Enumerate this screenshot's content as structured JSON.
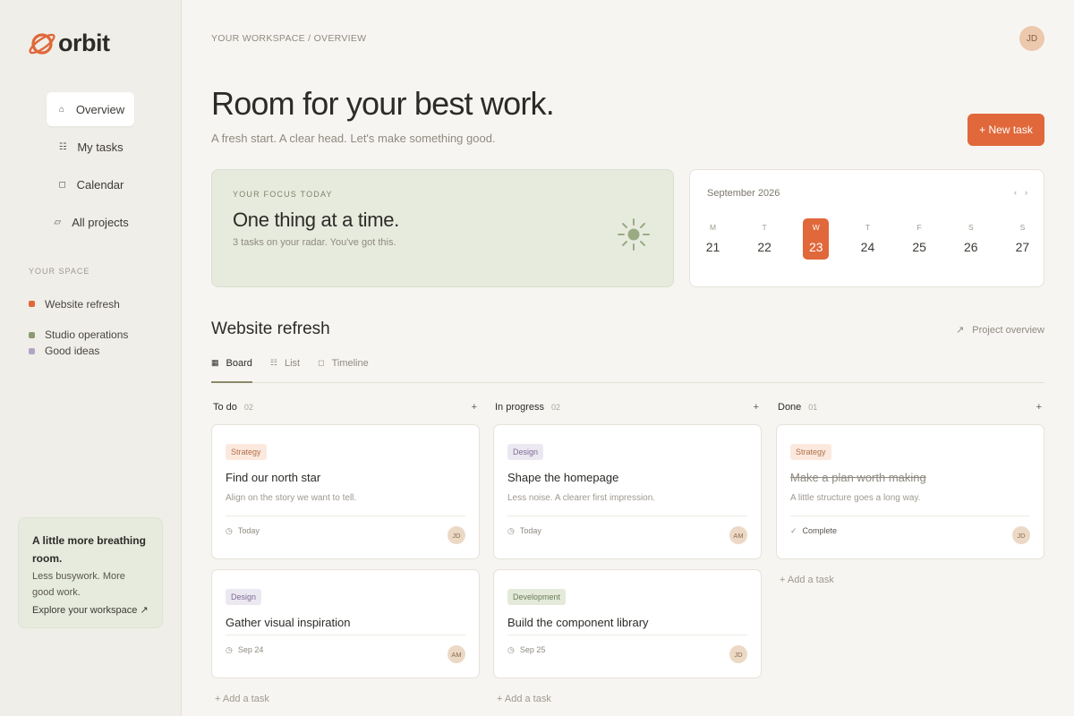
{
  "app": {
    "name": "orbit"
  },
  "sidebar": {
    "nav": [
      {
        "label": "Overview",
        "icon": "⌂",
        "active": true
      },
      {
        "label": "My tasks",
        "icon": "☷",
        "active": false
      },
      {
        "label": "Calendar",
        "icon": "◻",
        "active": false
      },
      {
        "label": "All projects",
        "icon": "▱",
        "active": false
      }
    ],
    "space_label": "YOUR SPACE",
    "spaces": [
      {
        "label": "Website refresh",
        "color": "#e0683a"
      },
      {
        "label": "Studio operations",
        "color": "#8a9a72"
      },
      {
        "label": "Good ideas",
        "color": "#b3a3c8"
      }
    ],
    "promo": {
      "title": "A little more breathing room.",
      "body": "Less busywork. More good work.",
      "link": "Explore your workspace ↗"
    }
  },
  "header": {
    "breadcrumb": "YOUR WORKSPACE / OVERVIEW",
    "avatar": "JD",
    "title": "Room for your best work.",
    "subtitle": "A fresh start. A clear head. Let's make something good.",
    "new_task": "+ New task"
  },
  "focus": {
    "label": "YOUR FOCUS TODAY",
    "title": "One thing at a time.",
    "subtitle": "3 tasks on your radar. You've got this."
  },
  "calendar": {
    "month": "September 2026",
    "prev": "‹",
    "next": "›",
    "days": [
      {
        "dow": "M",
        "num": "21",
        "active": false
      },
      {
        "dow": "T",
        "num": "22",
        "active": false
      },
      {
        "dow": "W",
        "num": "23",
        "active": true
      },
      {
        "dow": "T",
        "num": "24",
        "active": false
      },
      {
        "dow": "F",
        "num": "25",
        "active": false
      },
      {
        "dow": "S",
        "num": "26",
        "active": false
      },
      {
        "dow": "S",
        "num": "27",
        "active": false
      }
    ]
  },
  "project": {
    "title": "Website refresh",
    "overview_link": "Project overview",
    "tabs": [
      {
        "label": "Board",
        "icon": "▦",
        "active": true
      },
      {
        "label": "List",
        "icon": "☷",
        "active": false
      },
      {
        "label": "Timeline",
        "icon": "◻",
        "active": false
      }
    ]
  },
  "columns": [
    {
      "name": "To do",
      "count": "02",
      "add": "+",
      "add_task": "+ Add a task",
      "cards": [
        {
          "tag": "Strategy",
          "tag_type": "strategy",
          "title": "Find our north star",
          "desc": "Align on the story we want to tell.",
          "due": "Today",
          "due_icon": "◷",
          "avatar": "JD",
          "done": false
        },
        {
          "tag": "Design",
          "tag_type": "design",
          "title": "Gather visual inspiration",
          "desc": "",
          "due": "Sep 24",
          "due_icon": "◷",
          "avatar": "AM",
          "done": false
        }
      ]
    },
    {
      "name": "In progress",
      "count": "02",
      "add": "+",
      "add_task": "+ Add a task",
      "cards": [
        {
          "tag": "Design",
          "tag_type": "design",
          "title": "Shape the homepage",
          "desc": "Less noise. A clearer first impression.",
          "due": "Today",
          "due_icon": "◷",
          "avatar": "AM",
          "done": false
        },
        {
          "tag": "Development",
          "tag_type": "development",
          "title": "Build the component library",
          "desc": "",
          "due": "Sep 25",
          "due_icon": "◷",
          "avatar": "JD",
          "done": false
        }
      ]
    },
    {
      "name": "Done",
      "count": "01",
      "add": "+",
      "add_task": "+ Add a task",
      "cards": [
        {
          "tag": "Strategy",
          "tag_type": "strategy",
          "title": "Make a plan worth making",
          "desc": "A little structure goes a long way.",
          "due": "Complete",
          "due_icon": "✓",
          "avatar": "JD",
          "done": true
        }
      ]
    }
  ]
}
